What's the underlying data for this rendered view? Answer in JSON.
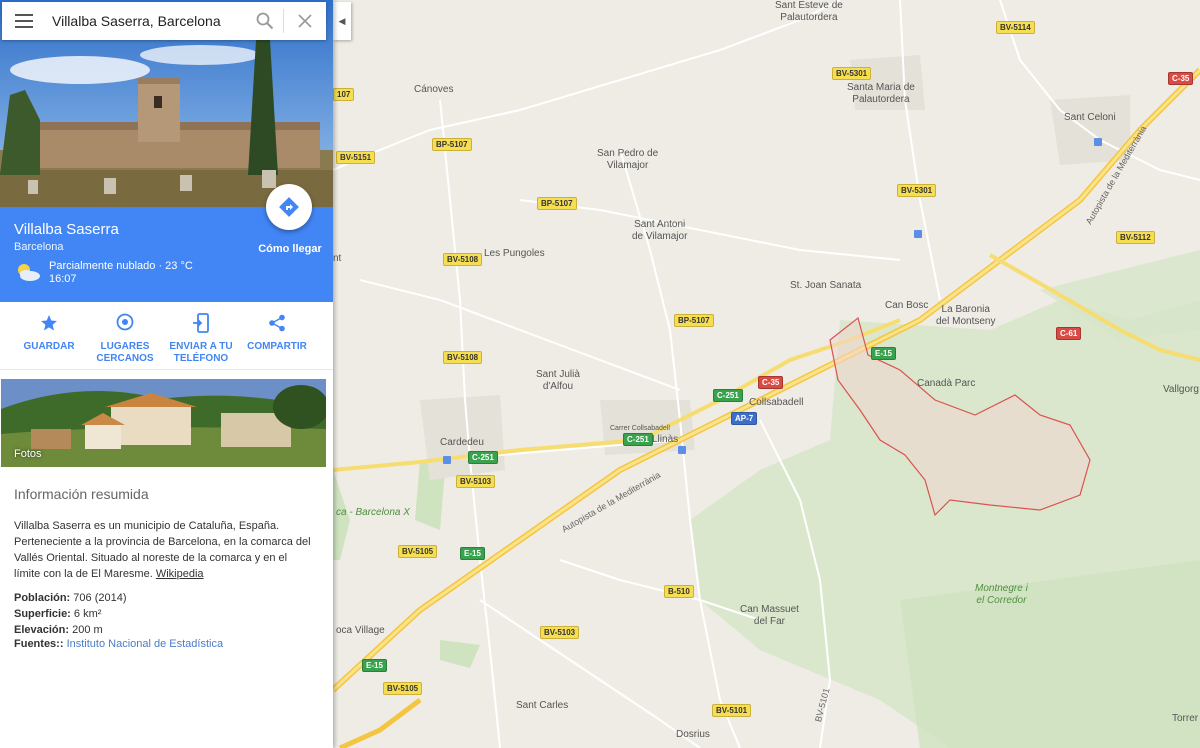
{
  "search": {
    "query": "Villalba Saserra, Barcelona"
  },
  "place": {
    "title": "Villalba Saserra",
    "subtitle": "Barcelona",
    "weather": "Parcialmente nublado · 23 °C",
    "time": "16:07",
    "directions_label": "Cómo llegar"
  },
  "actions": [
    {
      "label": "GUARDAR",
      "icon": "star-icon"
    },
    {
      "label": "LUGARES",
      "label2": "CERCANOS",
      "icon": "nearby-icon"
    },
    {
      "label": "ENVIAR A TU",
      "label2": "TELÉFONO",
      "icon": "send-to-phone-icon"
    },
    {
      "label": "COMPARTIR",
      "icon": "share-icon"
    }
  ],
  "photos": {
    "label": "Fotos"
  },
  "summary": {
    "heading": "Información resumida",
    "text": "Villalba Saserra es un municipio de Cataluña, España. Perteneciente a la provincia de Barcelona, en la comarca del Vallés Oriental. Situado al noreste de la comarca y en el límite con la de El Maresme.",
    "wiki": "Wikipedia",
    "facts": [
      {
        "key": "Población:",
        "value": "706 (2014)"
      },
      {
        "key": "Superficie:",
        "value": "6 km²"
      },
      {
        "key": "Elevación:",
        "value": "200 m"
      }
    ],
    "sources_key": "Fuentes::",
    "sources_value": "Instituto Nacional de Estadística"
  },
  "map": {
    "places": [
      {
        "name": "Sant Esteve de",
        "name2": "Palautordera"
      },
      {
        "name": "Cánoves"
      },
      {
        "name": "Santa Maria de",
        "name2": "Palautordera"
      },
      {
        "name": "Sant Celoni"
      },
      {
        "name": "San Pedro de",
        "name2": "Vilamajor"
      },
      {
        "name": "Sant Antoni",
        "name2": "de Vilamajor"
      },
      {
        "name": "Les Pungoles"
      },
      {
        "name": "St. Joan Sanata"
      },
      {
        "name": "Can Bosc"
      },
      {
        "name": "La Baronia",
        "name2": "del Montseny"
      },
      {
        "name": "Canadà Parc"
      },
      {
        "name": "Vallgorg"
      },
      {
        "name": "Sant Julià",
        "name2": "d'Alfou"
      },
      {
        "name": "Collsabadell"
      },
      {
        "name": "Cardedeu"
      },
      {
        "name": "Llinàs"
      },
      {
        "name": "Can Massuet",
        "name2": "del Far"
      },
      {
        "name": "Montnegre i",
        "name2": "el Corredor"
      },
      {
        "name": "oca Village"
      },
      {
        "name": "Sant Carles"
      },
      {
        "name": "Dosrius"
      },
      {
        "name": "Torrer"
      },
      {
        "name": "Carrer Collsabadell"
      },
      {
        "name": "ca - Barcelona X"
      },
      {
        "name": "nt"
      }
    ],
    "road_names": [
      {
        "name": "Autopista de la Mediterrània"
      },
      {
        "name": "Autopista de la Mediterrània"
      },
      {
        "name": "BV-5101"
      }
    ],
    "road_badges": [
      "BV-5114",
      "BV-5301",
      "C-35",
      "107",
      "BP-5107",
      "BV-5151",
      "BP-5107",
      "BV-5301",
      "BV-5112",
      "BV-5108",
      "BP-5107",
      "C-61",
      "E-15",
      "BV-5108",
      "C-35",
      "C-251",
      "AP-7",
      "C-251",
      "C-251",
      "BV-5103",
      "E-15",
      "BV-5105",
      "B-510",
      "BV-5103",
      "E-15",
      "BV-5105",
      "BV-5101"
    ]
  }
}
